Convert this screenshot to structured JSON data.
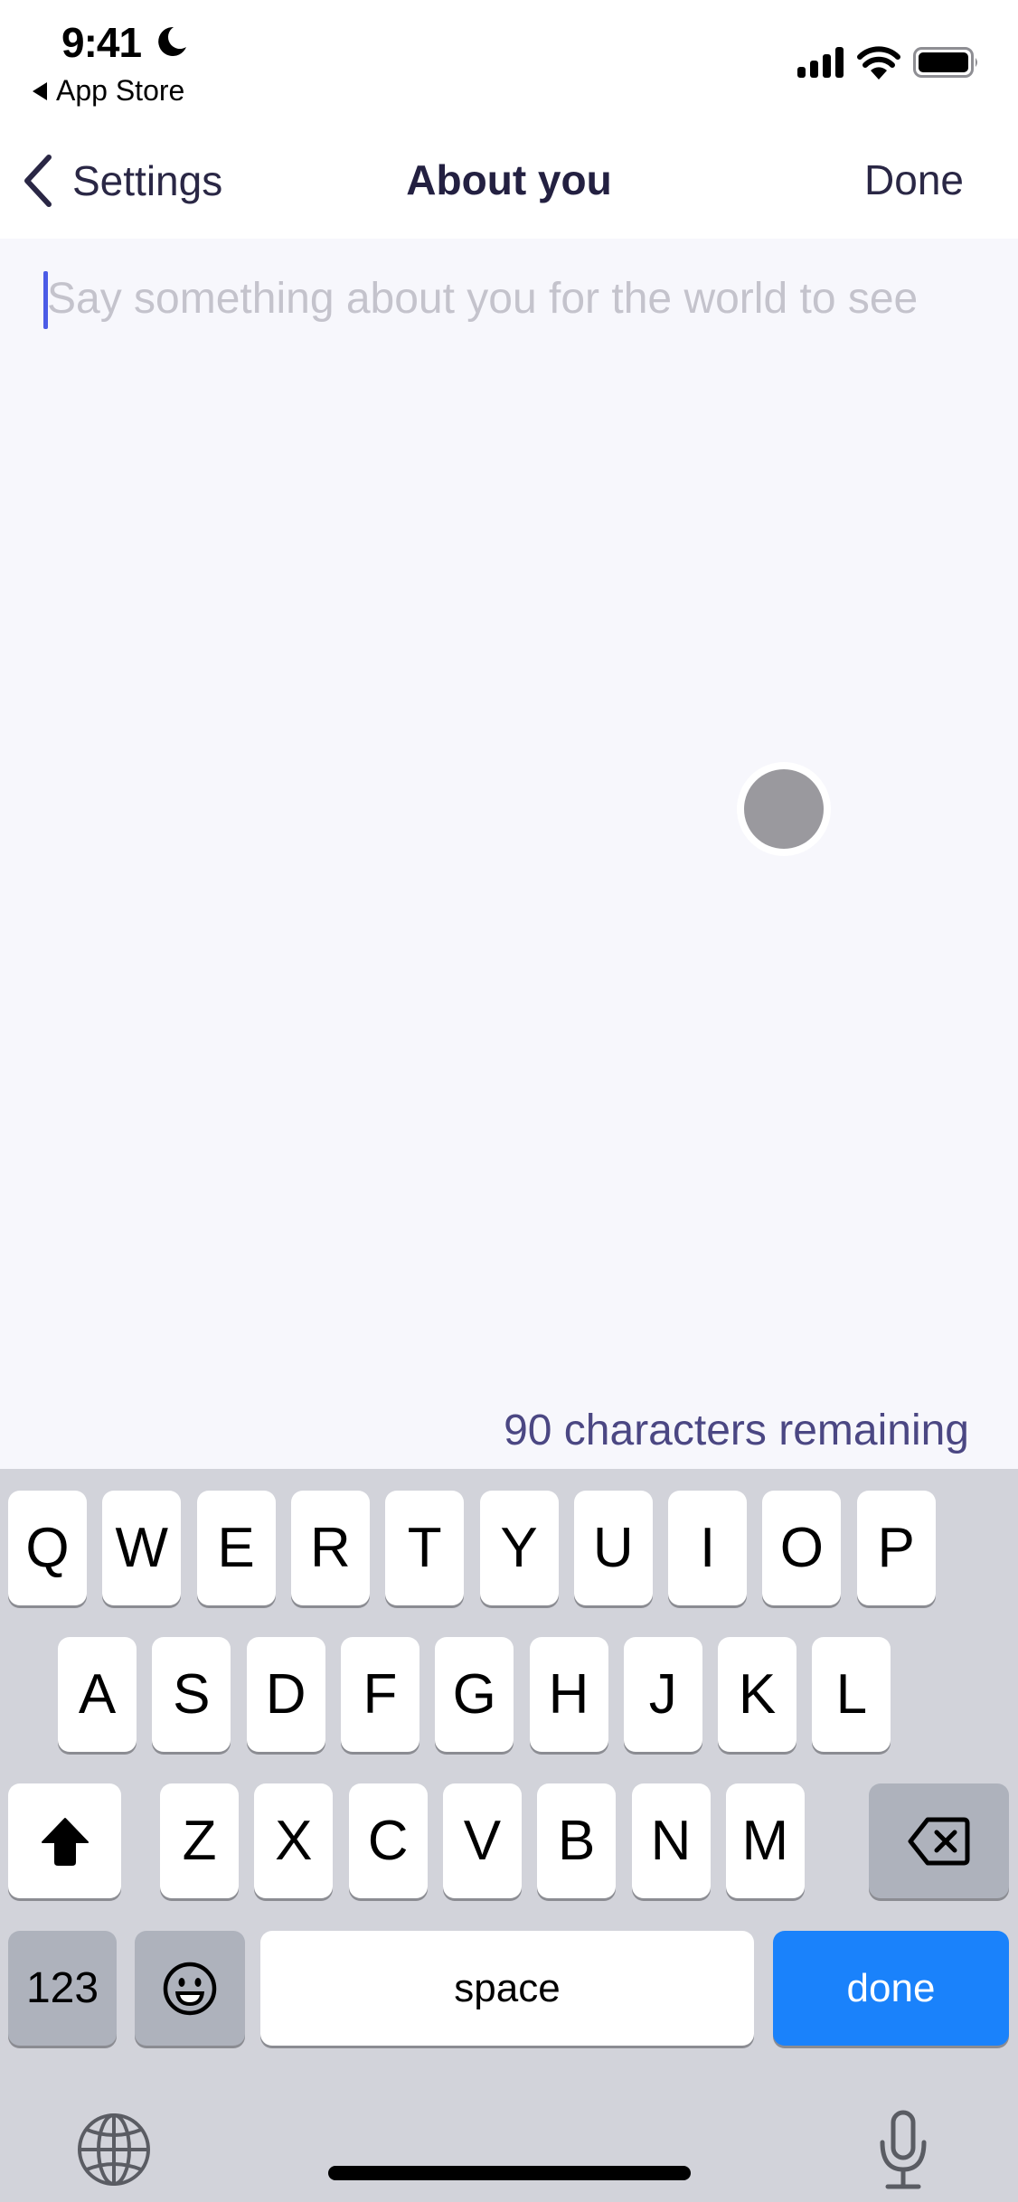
{
  "status_bar": {
    "time": "9:41",
    "focus_icon": "moon-icon",
    "back_to_app": "App Store",
    "icons": [
      "cellular-signal-icon",
      "wifi-icon",
      "battery-icon"
    ]
  },
  "nav": {
    "back_label": "Settings",
    "title": "About you",
    "done_label": "Done"
  },
  "editor": {
    "placeholder": "Say something about you for the world to see",
    "value": "",
    "remaining_text": "90 characters remaining"
  },
  "keyboard": {
    "row1": [
      "Q",
      "W",
      "E",
      "R",
      "T",
      "Y",
      "U",
      "I",
      "O",
      "P"
    ],
    "row2": [
      "A",
      "S",
      "D",
      "F",
      "G",
      "H",
      "J",
      "K",
      "L"
    ],
    "row3": [
      "Z",
      "X",
      "C",
      "V",
      "B",
      "N",
      "M"
    ],
    "shift_icon": "shift-icon",
    "backspace_icon": "backspace-icon",
    "numbers_label": "123",
    "emoji_icon": "emoji-icon",
    "space_label": "space",
    "return_label": "done",
    "globe_icon": "globe-icon",
    "mic_icon": "microphone-icon"
  },
  "colors": {
    "accent": "#1a82fb",
    "nav_text": "#2a2745",
    "counter_text": "#4b4783",
    "placeholder": "#c4c3cc",
    "caret": "#4b5be6"
  }
}
